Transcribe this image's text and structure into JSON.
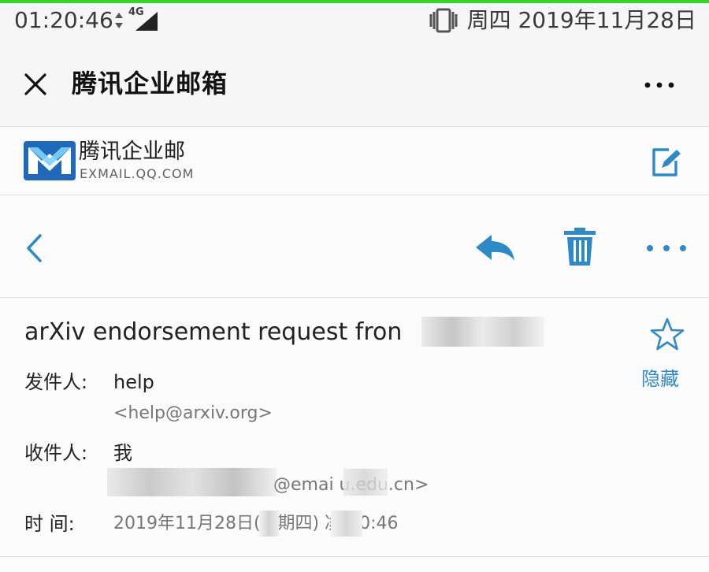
{
  "status_bar": {
    "time": "01:20:46",
    "network_type": "4G",
    "date": "周四 2019年11月28日"
  },
  "app_header": {
    "title": "腾讯企业邮箱",
    "close_icon": "close-icon",
    "more_icon": "more-horizontal-icon"
  },
  "mail_brand": {
    "name": "腾讯企业邮",
    "domain": "EXMAIL.QQ.COM",
    "logo": "exmail-logo",
    "compose_icon": "compose-icon"
  },
  "toolbar": {
    "back_icon": "chevron-left-icon",
    "reply_icon": "reply-icon",
    "delete_icon": "trash-icon",
    "more_icon": "more-horizontal-icon"
  },
  "message": {
    "subject": "arXiv endorsement request fron",
    "hide_label": "隐藏",
    "from_label": "发件人:",
    "from_name": "help",
    "from_email": "<help@arxiv.org>",
    "to_label": "收件人:",
    "to_name": "我",
    "to_email_visible": "@emai    u.edu.cn>",
    "time_label": "时 间:",
    "time_value": "2019年11月28日(星期四) 凌晨0:46"
  },
  "colors": {
    "accent_blue": "#2f89c8",
    "status_green": "#39d12c",
    "background": "#f6f6f6"
  }
}
